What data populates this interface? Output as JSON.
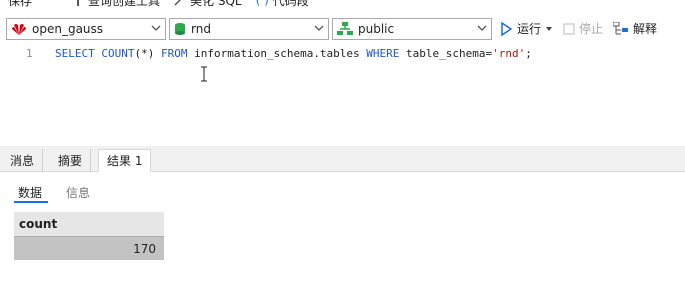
{
  "top_toolbar": {
    "save_label": "保存",
    "query_builder_label": "查询创建工具",
    "beautify_label": "美化 SQL",
    "snippet_label": "代码段"
  },
  "connection": {
    "server": "open_gauss",
    "database": "rnd",
    "schema": "public"
  },
  "actions": {
    "run_label": "运行",
    "stop_label": "停止",
    "explain_label": "解释"
  },
  "editor": {
    "line_number": "1",
    "sql_kw1": "SELECT COUNT",
    "sql_part1": "(*) ",
    "sql_kw2": "FROM",
    "sql_part2": " information_schema.tables ",
    "sql_kw3": "WHERE",
    "sql_part3": " table_schema=",
    "sql_string": "'rnd'",
    "sql_end": ";"
  },
  "result_tabs": [
    "消息",
    "摘要",
    "结果 1"
  ],
  "sub_tabs": [
    "数据",
    "信息"
  ],
  "grid": {
    "column": "count",
    "rows": [
      "170"
    ]
  },
  "colors": {
    "keyword": "#1f57c7",
    "string": "#b01818",
    "accent": "#1e6fd9",
    "huawei_red": "#d7000f",
    "db_green": "#2fa84f"
  }
}
